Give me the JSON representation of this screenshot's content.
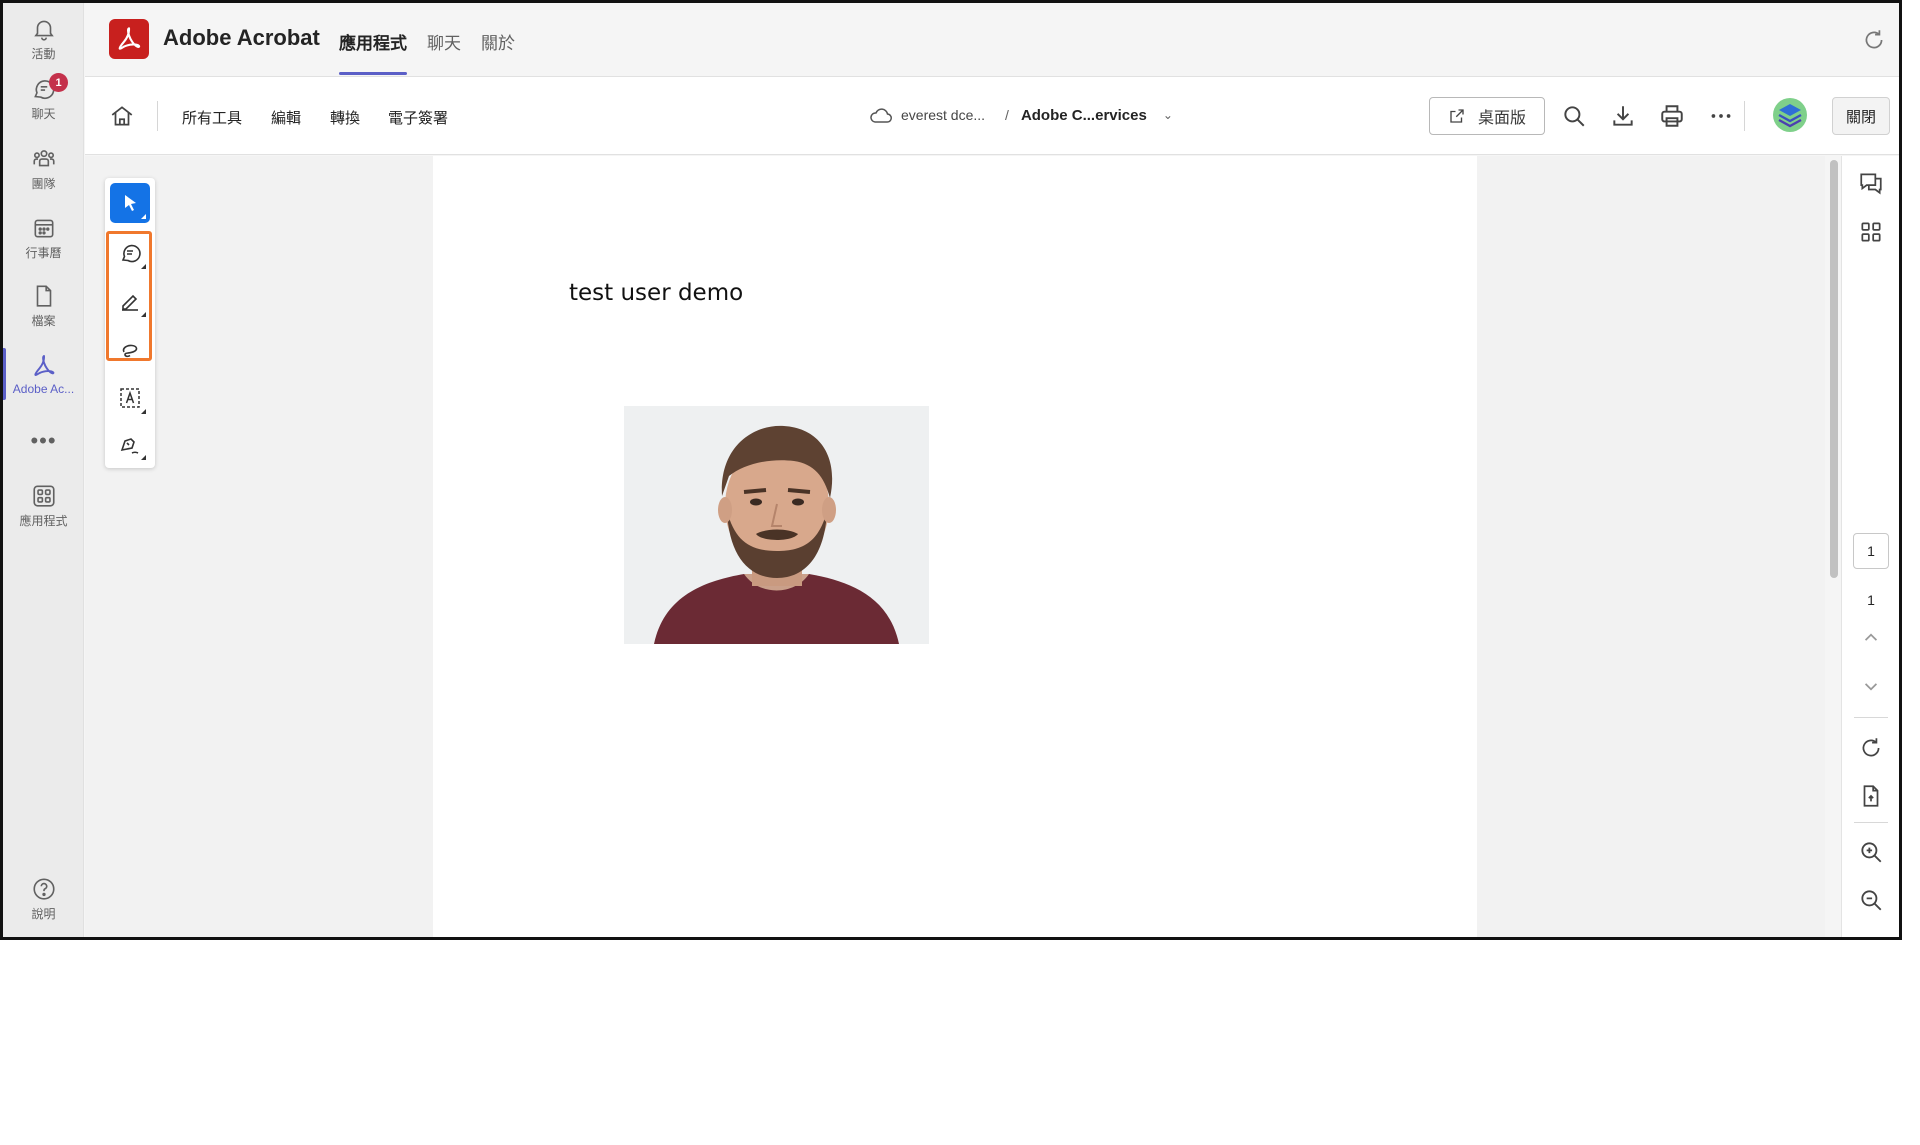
{
  "rail": {
    "items": [
      {
        "label": "活動",
        "icon": "bell-icon"
      },
      {
        "label": "聊天",
        "icon": "chat-icon",
        "badge": "1"
      },
      {
        "label": "團隊",
        "icon": "teams-icon"
      },
      {
        "label": "行事曆",
        "icon": "calendar-icon"
      },
      {
        "label": "檔案",
        "icon": "file-icon"
      },
      {
        "label": "Adobe Ac...",
        "icon": "acrobat-icon"
      },
      {
        "label": "應用程式",
        "icon": "apps-icon"
      }
    ],
    "more": "•••",
    "help_label": "說明"
  },
  "appbar": {
    "title": "Adobe Acrobat",
    "tabs": [
      "應用程式",
      "聊天",
      "關於"
    ],
    "active_tab": "應用程式"
  },
  "toolbar": {
    "menus": [
      "所有工具",
      "編輯",
      "轉換",
      "電子簽署"
    ],
    "breadcrumb_location": "everest dce...",
    "breadcrumb_sep": "/",
    "document_name": "Adobe C...ervices",
    "desktop_button": "桌面版",
    "close_button": "關閉"
  },
  "document": {
    "text": "test user demo"
  },
  "tools": {
    "items": [
      "select-tool",
      "comment-tool",
      "draw-tool",
      "lasso-tool",
      "text-recognize-tool",
      "signature-tool"
    ],
    "selected": "select-tool"
  },
  "pager": {
    "current": "1",
    "total": "1"
  },
  "colors": {
    "accent": "#5b5fc7",
    "acrobat_red": "#c8201e",
    "select_blue": "#1473e6",
    "highlight_orange": "#f0782d",
    "badge_red": "#c4314b"
  }
}
